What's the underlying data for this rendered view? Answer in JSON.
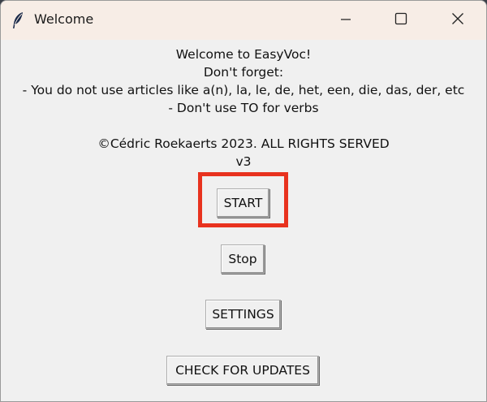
{
  "window": {
    "title": "Welcome",
    "icons": {
      "app": "feather-icon",
      "minimize": "minimize-icon",
      "maximize": "maximize-icon",
      "close": "close-icon"
    }
  },
  "message": {
    "line1": "Welcome to EasyVoc!",
    "line2": "Don't forget:",
    "line3": "- You do not use articles like a(n), la, le, de, het, een, die, das, der, etc",
    "line4": "- Don't use TO for verbs",
    "copyright": "©Cédric Roekaerts 2023. ALL RIGHTS SERVED",
    "version": "v3"
  },
  "buttons": {
    "start": "START",
    "stop": "Stop",
    "settings": "SETTINGS",
    "check_updates": "CHECK FOR UPDATES"
  },
  "colors": {
    "titlebar": "#f7ede6",
    "background": "#f0f0f0",
    "highlight": "#e8321e"
  }
}
